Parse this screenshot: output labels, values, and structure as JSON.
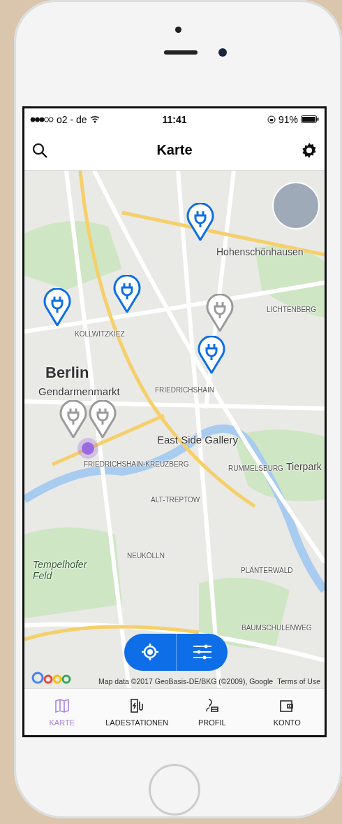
{
  "status_bar": {
    "carrier": "o2 - de",
    "time": "11:41",
    "battery": "91%"
  },
  "header": {
    "title": "Karte"
  },
  "map": {
    "labels": [
      {
        "text": "Hohenschönhausen",
        "kind": "district"
      },
      {
        "text": "LICHTENBERG",
        "kind": "area"
      },
      {
        "text": "KOLLWITZKIEZ",
        "kind": "area"
      },
      {
        "text": "Berlin",
        "kind": "city"
      },
      {
        "text": "Gendarmenmarkt",
        "kind": "poi"
      },
      {
        "text": "FRIEDRICHSHAIN",
        "kind": "area"
      },
      {
        "text": "East Side Gallery",
        "kind": "poi"
      },
      {
        "text": "FRIEDRICHSHAIN-KREUZBERG",
        "kind": "area"
      },
      {
        "text": "RUMMELSBURG",
        "kind": "area"
      },
      {
        "text": "Tierpark",
        "kind": "district"
      },
      {
        "text": "ALT-TREPTOW",
        "kind": "area"
      },
      {
        "text": "Tempelhofer Feld",
        "kind": "park"
      },
      {
        "text": "NEUKÖLLN",
        "kind": "area"
      },
      {
        "text": "PLÄNTERWALD",
        "kind": "area"
      },
      {
        "text": "BAUMSCHULENWEG",
        "kind": "area"
      }
    ],
    "pins": [
      {
        "kind": "available"
      },
      {
        "kind": "available"
      },
      {
        "kind": "available"
      },
      {
        "kind": "occupied"
      },
      {
        "kind": "available"
      },
      {
        "kind": "occupied"
      },
      {
        "kind": "occupied"
      }
    ],
    "attribution": "Map data ©2017 GeoBasis-DE/BKG (©2009), Google",
    "terms_link": "Terms of Use"
  },
  "tabs": [
    {
      "label": "KARTE",
      "selected": true
    },
    {
      "label": "LADESTATIONEN",
      "selected": false
    },
    {
      "label": "PROFIL",
      "selected": false
    },
    {
      "label": "KONTO",
      "selected": false
    }
  ]
}
